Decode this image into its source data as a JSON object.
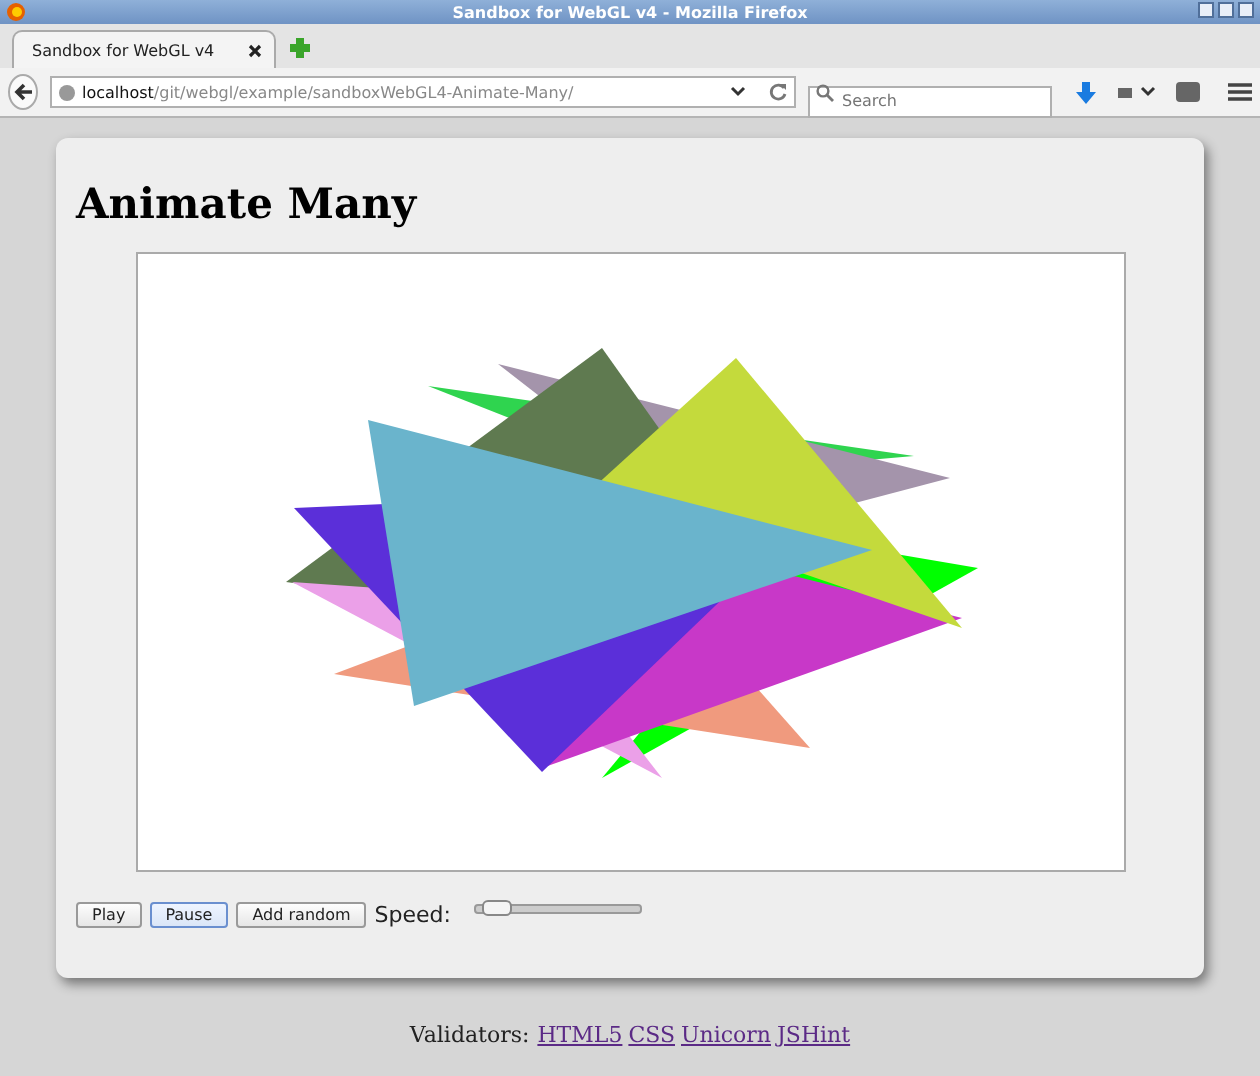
{
  "window": {
    "title": "Sandbox for WebGL v4 - Mozilla Firefox"
  },
  "tabs": [
    {
      "label": "Sandbox for WebGL v4",
      "selected": true
    }
  ],
  "address_bar": {
    "host": "localhost",
    "path": "/git/webgl/example/sandboxWebGL4-Animate-Many/"
  },
  "search": {
    "placeholder": "Search"
  },
  "page": {
    "heading": "Animate Many",
    "buttons": [
      {
        "label": "Play",
        "focused": false
      },
      {
        "label": "Pause",
        "focused": true
      },
      {
        "label": "Add random",
        "focused": false
      }
    ],
    "speed": {
      "label": "Speed:",
      "level": 0.04
    }
  },
  "footer": {
    "label": "Validators:",
    "links": [
      "HTML5",
      "CSS",
      "Unicorn",
      "JSHint"
    ]
  }
}
